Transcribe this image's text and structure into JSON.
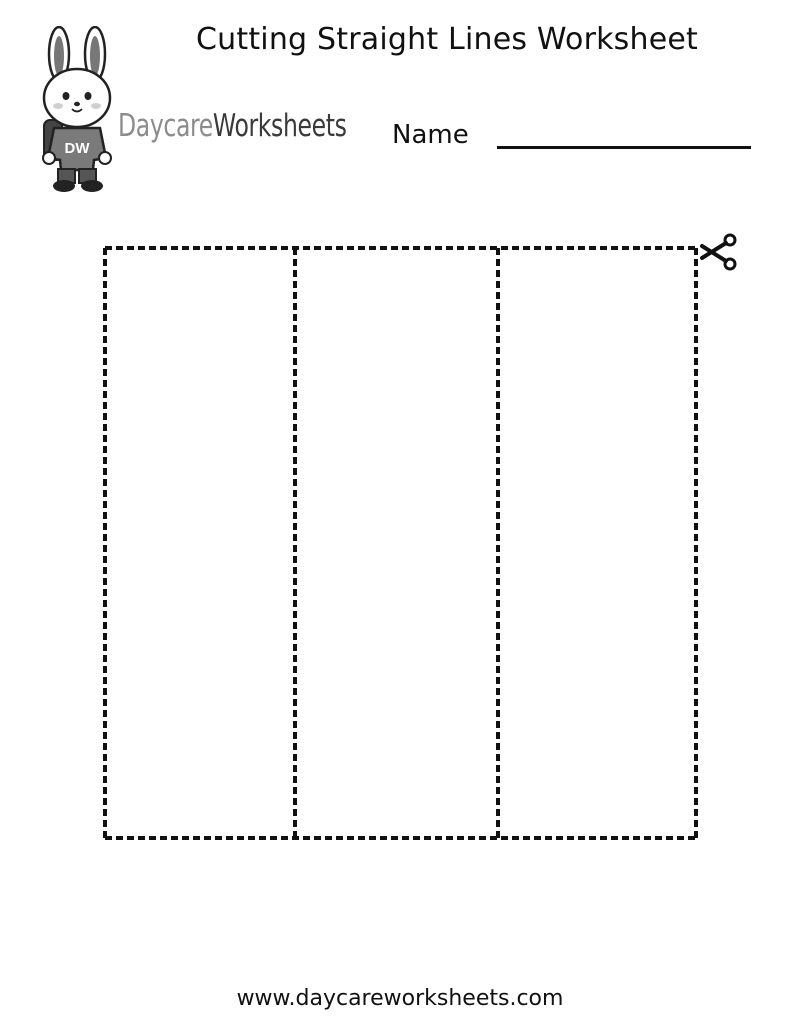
{
  "header": {
    "title": "Cutting Straight Lines Worksheet",
    "brand_part1": "Daycare",
    "brand_part2": "Worksheets",
    "mascot_shirt_text": "DW",
    "name_label": "Name"
  },
  "worksheet": {
    "cut_columns": 3,
    "icons": [
      "scissors-icon"
    ]
  },
  "footer": {
    "url": "www.daycareworksheets.com"
  },
  "colors": {
    "text": "#111111",
    "brand_light": "#8c8c8c",
    "brand_dark": "#3a3a3a"
  }
}
